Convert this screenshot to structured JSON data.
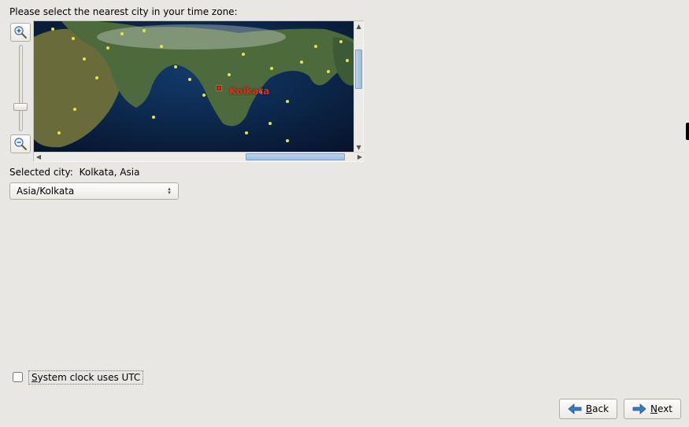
{
  "instructions": "Please select the nearest city in your time zone:",
  "map": {
    "selected_marker_label": "Kolkata"
  },
  "selected": {
    "label": "Selected city:",
    "value": "Kolkata, Asia"
  },
  "timezone_select": {
    "value": "Asia/Kolkata"
  },
  "utc_checkbox": {
    "checked": false,
    "mnemonic": "S",
    "rest": "ystem clock uses UTC"
  },
  "nav": {
    "back": {
      "mnemonic": "B",
      "rest": "ack"
    },
    "next": {
      "mnemonic": "N",
      "rest": "ext"
    }
  }
}
